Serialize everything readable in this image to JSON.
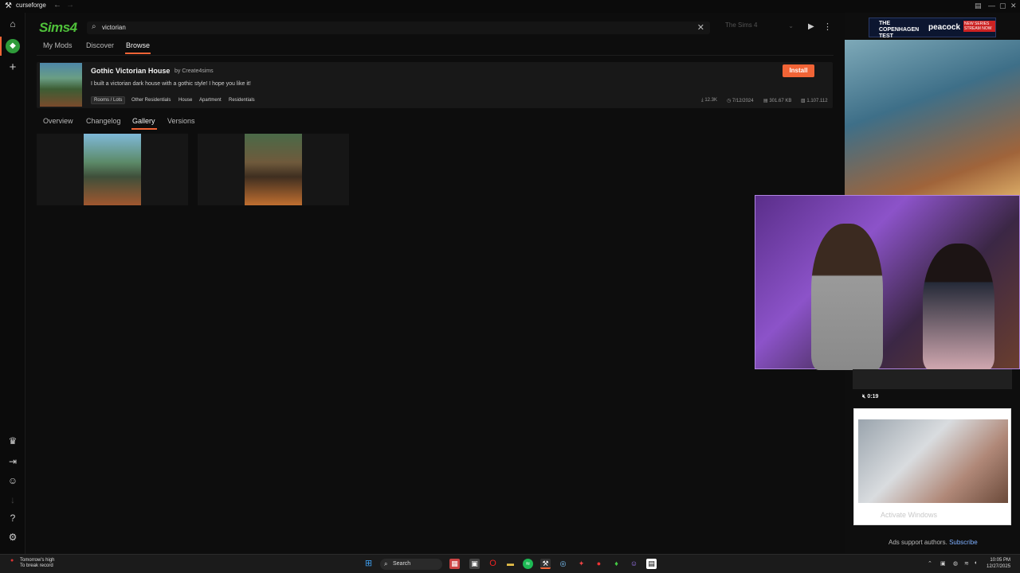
{
  "titlebar": {
    "app_name": "curseforge"
  },
  "header": {
    "game_logo_text": "Sims4",
    "search": {
      "value": "victorian"
    },
    "game_select": "The Sims 4"
  },
  "main_tabs": [
    {
      "label": "My Mods",
      "active": false
    },
    {
      "label": "Discover",
      "active": false
    },
    {
      "label": "Browse",
      "active": true
    }
  ],
  "project": {
    "title": "Gothic Victorian House",
    "author": "by Create4sims",
    "description": "I built a victorian dark house with a gothic style! I hope you like it!",
    "categories": [
      "Rooms / Lots",
      "Other Residentials",
      "House",
      "Apartment",
      "Residentials"
    ],
    "downloads": "12.3K",
    "updated": "7/12/2024",
    "file_size": "301.67 KB",
    "game_version": "1.107.112",
    "install_label": "Install"
  },
  "detail_tabs": [
    {
      "label": "Overview",
      "active": false
    },
    {
      "label": "Changelog",
      "active": false
    },
    {
      "label": "Gallery",
      "active": true
    },
    {
      "label": "Versions",
      "active": false
    }
  ],
  "right_panel": {
    "ad_banner": {
      "title": "THE COPENHAGEN TEST",
      "brand": "peacock",
      "badge": "NEW SERIES STREAM NOW"
    },
    "video_time": "0:19",
    "activate_windows": "Activate Windows",
    "ads_support": "Ads support authors.",
    "subscribe": "Subscribe"
  },
  "taskbar": {
    "weather_title": "Tomorrow's high",
    "weather_sub": "To break record",
    "search_label": "Search",
    "clock_time": "10:05 PM",
    "clock_date": "12/27/2025"
  },
  "colors": {
    "accent": "#f16436",
    "sims_green": "#4fc13a"
  }
}
